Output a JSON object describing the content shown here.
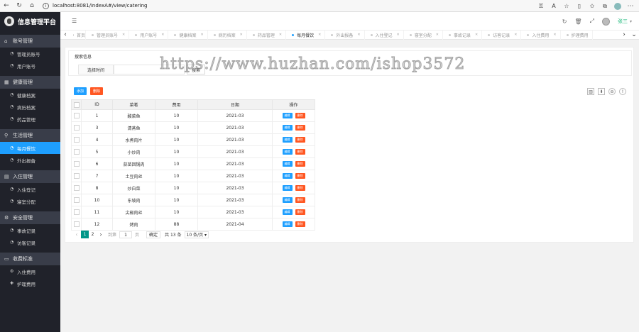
{
  "browser": {
    "url": "localhost:8081/indexA#/view/catering"
  },
  "sidebar": {
    "title": "信息管理平台",
    "groups": [
      {
        "label": "账号管理",
        "items": [
          {
            "label": "管理员账号"
          },
          {
            "label": "用户账号"
          }
        ]
      },
      {
        "label": "健康管理",
        "items": [
          {
            "label": "健康档案"
          },
          {
            "label": "病历档案"
          },
          {
            "label": "药品管理"
          }
        ]
      },
      {
        "label": "生活管理",
        "items": [
          {
            "label": "每月餐饮"
          },
          {
            "label": "外出报备"
          }
        ]
      },
      {
        "label": "入住管理",
        "items": [
          {
            "label": "入住登记"
          },
          {
            "label": "寝室分配"
          }
        ]
      },
      {
        "label": "安全管理",
        "items": [
          {
            "label": "事故记录"
          },
          {
            "label": "访客记录"
          }
        ]
      },
      {
        "label": "收费标准",
        "items": [
          {
            "label": "入住费用"
          },
          {
            "label": "护理费用"
          }
        ]
      }
    ],
    "active_item": "每月餐饮"
  },
  "header": {
    "user_name": "张三"
  },
  "tabs": [
    {
      "label": "首页"
    },
    {
      "label": "管理员账号"
    },
    {
      "label": "用户账号"
    },
    {
      "label": "健康档案"
    },
    {
      "label": "病历档案"
    },
    {
      "label": "药品管理"
    },
    {
      "label": "每月餐饮"
    },
    {
      "label": "外出报备"
    },
    {
      "label": "入住登记"
    },
    {
      "label": "寝室分配"
    },
    {
      "label": "事故记录"
    },
    {
      "label": "访客记录"
    },
    {
      "label": "入住费用"
    },
    {
      "label": "护理费用"
    }
  ],
  "search": {
    "panel_title": "搜索信息",
    "field_label": "选择时间",
    "field_value": "",
    "button_label": "搜索"
  },
  "toolbar": {
    "add_label": "添加",
    "delete_label": "删除"
  },
  "table": {
    "columns": [
      "ID",
      "菜肴",
      "费用",
      "日期",
      "操作"
    ],
    "edit_label": "编辑",
    "delete_label": "删除",
    "rows": [
      {
        "id": "1",
        "dish": "酸菜鱼",
        "fee": "10",
        "date": "2021-03"
      },
      {
        "id": "3",
        "dish": "清蒸鱼",
        "fee": "10",
        "date": "2021-03"
      },
      {
        "id": "4",
        "dish": "水煮肉片",
        "fee": "10",
        "date": "2021-03"
      },
      {
        "id": "5",
        "dish": "小炒肉",
        "fee": "10",
        "date": "2021-03"
      },
      {
        "id": "6",
        "dish": "蒜苗回锅肉",
        "fee": "10",
        "date": "2021-03"
      },
      {
        "id": "7",
        "dish": "土豆肉丝",
        "fee": "10",
        "date": "2021-03"
      },
      {
        "id": "8",
        "dish": "炒白菜",
        "fee": "10",
        "date": "2021-03"
      },
      {
        "id": "10",
        "dish": "东坡肉",
        "fee": "10",
        "date": "2021-03"
      },
      {
        "id": "11",
        "dish": "尖椒肉丝",
        "fee": "10",
        "date": "2021-03"
      },
      {
        "id": "12",
        "dish": "烤肉",
        "fee": "88",
        "date": "2021-04"
      }
    ]
  },
  "pager": {
    "pages": [
      "1",
      "2"
    ],
    "current": "1",
    "goto_label": "到第",
    "goto_value": "1",
    "page_unit": "页",
    "confirm_label": "确定",
    "total_label": "共 13 条",
    "page_size_label": "10 条/页"
  },
  "watermark": "https://www.huzhan.com/ishop3572"
}
